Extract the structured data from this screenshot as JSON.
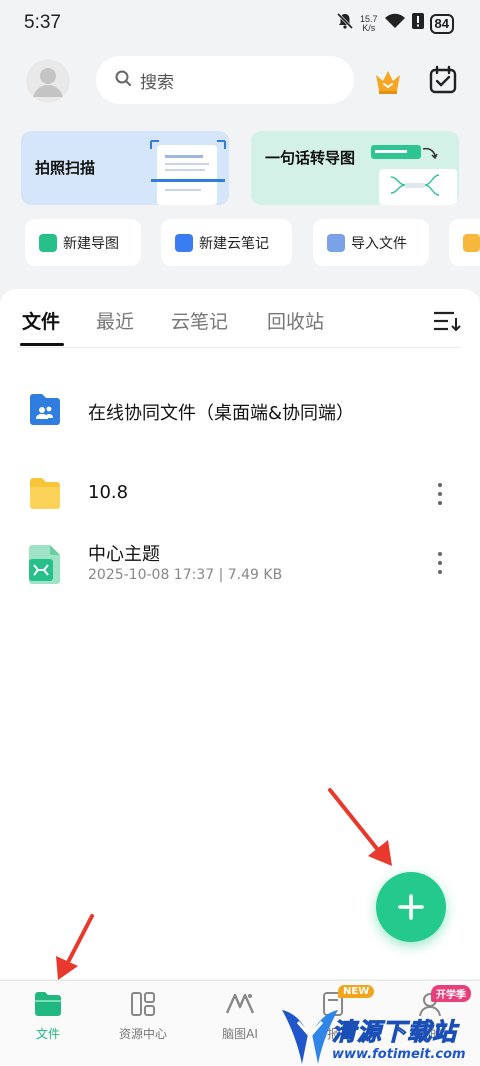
{
  "status_bar": {
    "time": "5:37",
    "net_speed_value": "15.7",
    "net_speed_unit": "K/s",
    "battery": "84"
  },
  "header": {
    "search_placeholder": "搜索"
  },
  "feature_cards": [
    {
      "label": "拍照扫描"
    },
    {
      "label": "一句话转导图"
    }
  ],
  "quick_actions": [
    {
      "label": "新建导图",
      "icon": "mindmap-icon",
      "color": "#27c08a"
    },
    {
      "label": "新建云笔记",
      "icon": "cloud-note-icon",
      "color": "#3a7df2"
    },
    {
      "label": "导入文件",
      "icon": "import-file-icon",
      "color": "#7aa2e6"
    }
  ],
  "tabs": [
    "文件",
    "最近",
    "云笔记",
    "回收站"
  ],
  "files": [
    {
      "name": "在线协同文件（桌面端&协同端）",
      "icon": "shared-folder-icon"
    },
    {
      "name": "10.8",
      "icon": "folder-icon"
    },
    {
      "name": "中心主题",
      "meta": "2025-10-08 17:37 | 7.49 KB",
      "icon": "mindmap-file-icon"
    }
  ],
  "bottom_nav": [
    {
      "label": "文件",
      "icon": "folder-icon",
      "active": true
    },
    {
      "label": "资源中心",
      "icon": "resource-grid-icon",
      "active": false
    },
    {
      "label": "脑图AI",
      "icon": "ai-icon",
      "active": false
    },
    {
      "label": "海报长",
      "icon": "poster-icon",
      "active": false,
      "badge": "NEW"
    },
    {
      "label": "我的",
      "icon": "profile-icon",
      "active": false,
      "badge": "开学季"
    }
  ],
  "watermark": {
    "title": "清源下载站",
    "url": "www.fotimeit.com"
  },
  "colors": {
    "accent": "#24c98c",
    "background": "#f2f3f5"
  }
}
